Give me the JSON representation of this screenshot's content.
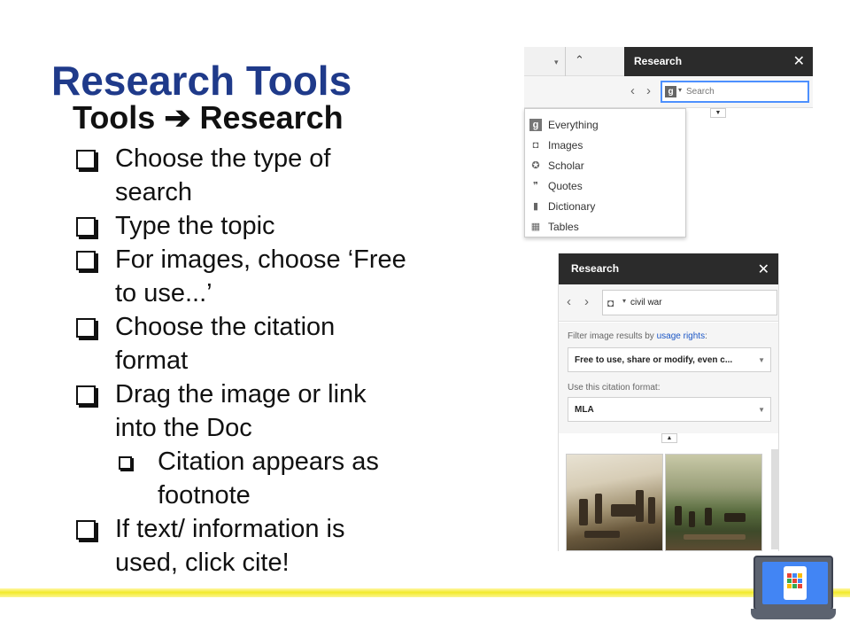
{
  "slide": {
    "title": "Research Tools",
    "subtitle": "Tools ➔ Research",
    "bullets": [
      {
        "text": "Choose the type of search"
      },
      {
        "text": "Type the topic"
      },
      {
        "text": "For images, choose ‘Free to use...’"
      },
      {
        "text": "Choose the citation format"
      },
      {
        "text": "Drag the image or link into the Doc"
      },
      {
        "text": "Citation appears as footnote"
      },
      {
        "text": "If text/ information is used, click cite!"
      }
    ]
  },
  "panel_top": {
    "header_title": "Research",
    "close_glyph": "✕",
    "back_glyph": "‹",
    "forward_glyph": "›",
    "search_placeholder": "Search",
    "menu_items": [
      {
        "icon": "g-icon",
        "glyph": "g",
        "label": "Everything"
      },
      {
        "icon": "camera-icon",
        "glyph": "◘",
        "label": "Images"
      },
      {
        "icon": "scholar-icon",
        "glyph": "✪",
        "label": "Scholar"
      },
      {
        "icon": "quote-icon",
        "glyph": "❞",
        "label": "Quotes"
      },
      {
        "icon": "book-icon",
        "glyph": "▮",
        "label": "Dictionary"
      },
      {
        "icon": "table-icon",
        "glyph": "▦",
        "label": "Tables"
      }
    ]
  },
  "panel_bottom": {
    "header_title": "Research",
    "close_glyph": "✕",
    "back_glyph": "‹",
    "forward_glyph": "›",
    "search_value": "civil war",
    "filter_prefix": "Filter image results by ",
    "filter_link": "usage rights",
    "filter_suffix": ":",
    "usage_rights_value": "Free to use, share or modify, even c...",
    "citation_label": "Use this citation format:",
    "citation_value": "MLA"
  },
  "colors": {
    "title": "#1f3a8a",
    "header_bg": "#2b2b2b",
    "focus_border": "#4d90fe",
    "link": "#1a55c5",
    "footer_line": "#f2ea2a"
  }
}
